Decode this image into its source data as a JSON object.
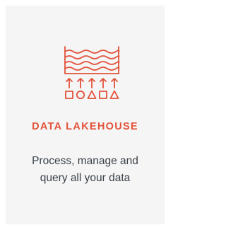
{
  "card": {
    "icon": "data-lakehouse-icon",
    "title": "DATA LAKEHOUSE",
    "description_lines": [
      "Process, manage and",
      "query all your data"
    ]
  },
  "colors": {
    "accent": "#e2533b",
    "card_background": "#f5f5f5",
    "text": "#3a4149"
  }
}
